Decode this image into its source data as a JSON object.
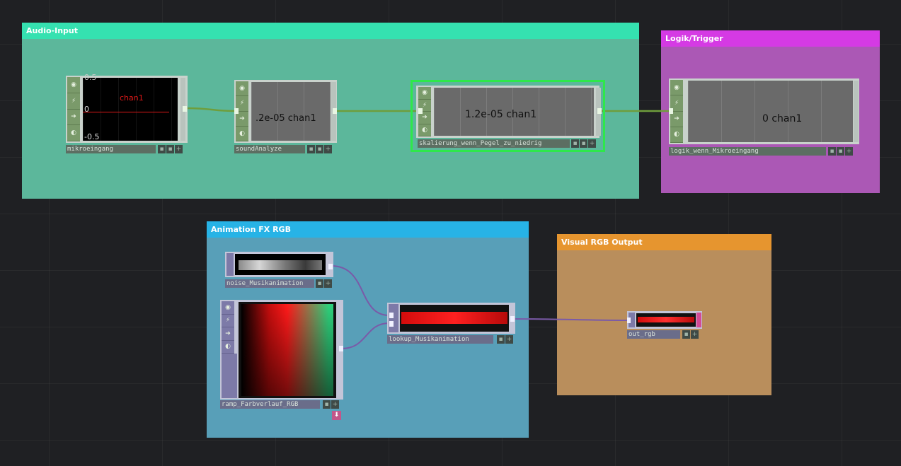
{
  "annotations": {
    "audio_input": {
      "title": "Audio-Input",
      "color": "#3ddfae"
    },
    "logic_trigger": {
      "title": "Logik/Trigger",
      "color": "#d838e6"
    },
    "animation_fx": {
      "title": "Animation FX RGB",
      "color": "#27b2e6"
    },
    "visual_output": {
      "title": "Visual RGB Output",
      "color": "#e8952f"
    }
  },
  "nodes": {
    "mikroeingang": {
      "name": "mikroeingang",
      "channel": "chan1",
      "top_value": "0.5",
      "zero_value": "0",
      "bottom_value": "-0.5"
    },
    "soundanalyze": {
      "name": "soundAnalyze",
      "value": ".2e-05 chan1"
    },
    "skalierung": {
      "name": "skalierung_wenn_Pegel_zu_niedrig",
      "value": "1.2e-05 chan1"
    },
    "logik": {
      "name": "logik_wenn_Mikroeingang",
      "value": "0 chan1"
    },
    "noise": {
      "name": "noise_Musikanimation"
    },
    "ramp": {
      "name": "ramp_Farbverlauf_RGB"
    },
    "lookup": {
      "name": "lookup_Musikanimation"
    },
    "out_rgb": {
      "name": "out_rgb"
    }
  },
  "colors": {
    "chop_wire": "#6a9a3a",
    "top_wire": "#7a5aa8",
    "selected_outline": "#2ee84a"
  }
}
